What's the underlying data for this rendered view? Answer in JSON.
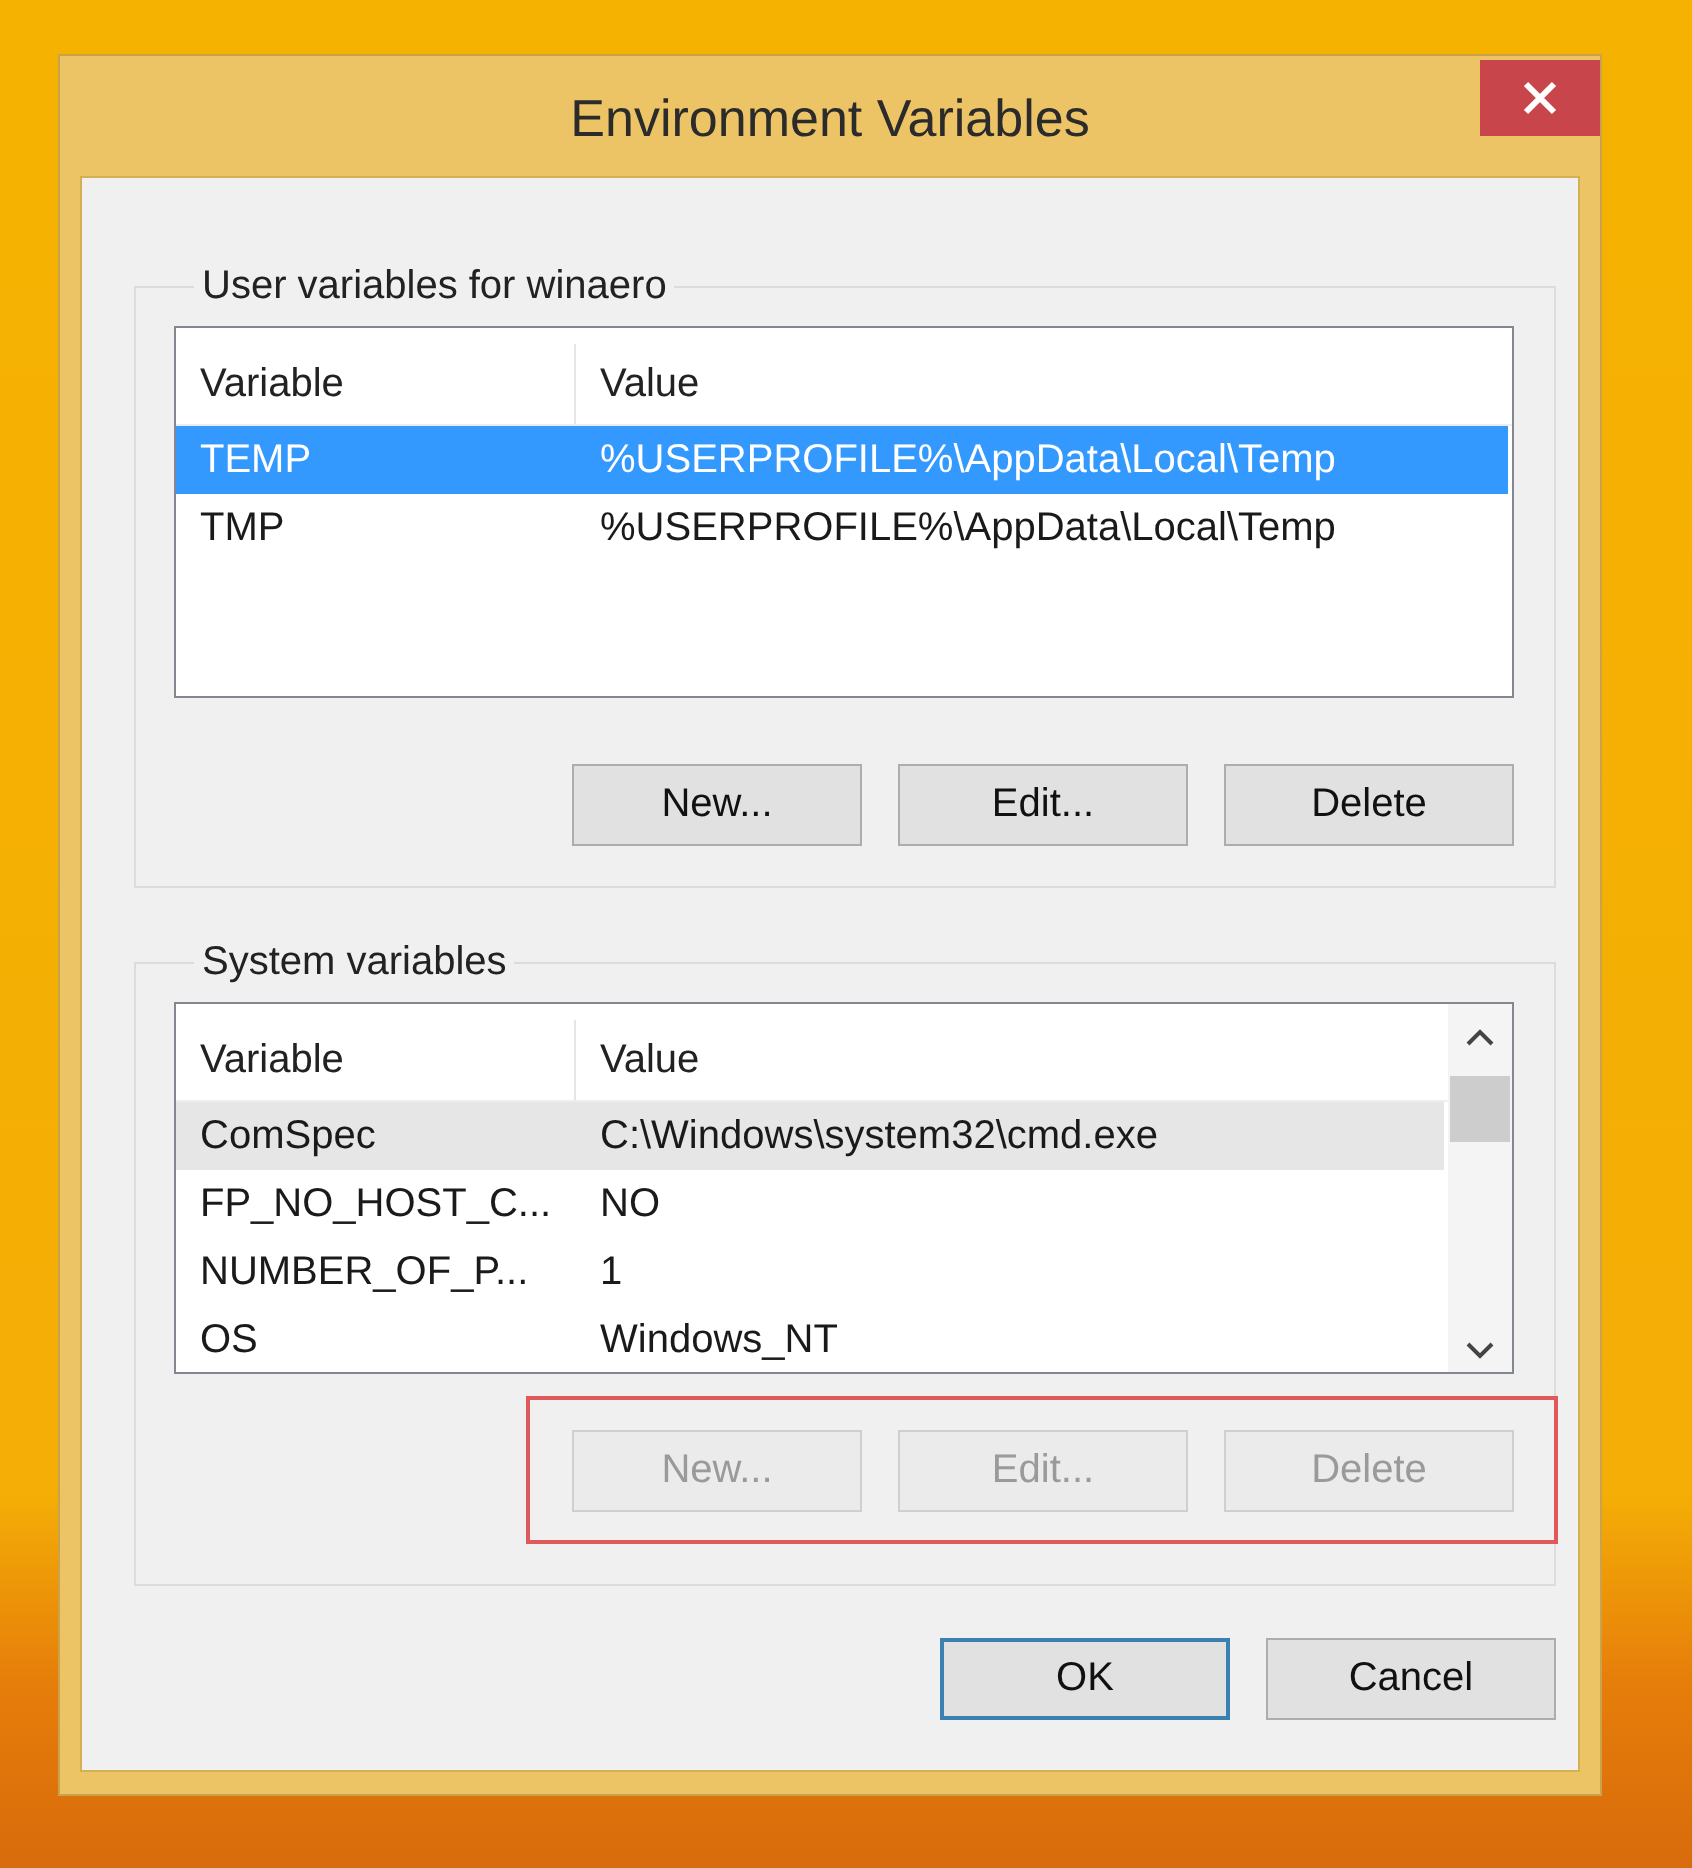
{
  "window": {
    "title": "Environment Variables"
  },
  "user_variables": {
    "title": "User variables for winaero",
    "focused": true,
    "highlighted": false,
    "scrollbar": false,
    "columns": [
      "Variable",
      "Value"
    ],
    "rows": [
      {
        "variable": "TEMP",
        "value": "%USERPROFILE%\\AppData\\Local\\Temp",
        "selected": true
      },
      {
        "variable": "TMP",
        "value": "%USERPROFILE%\\AppData\\Local\\Temp",
        "selected": false
      }
    ],
    "buttons": [
      {
        "label": "New...",
        "disabled": false
      },
      {
        "label": "Edit...",
        "disabled": false
      },
      {
        "label": "Delete",
        "disabled": false
      }
    ]
  },
  "system_variables": {
    "title": "System variables",
    "focused": false,
    "highlighted": true,
    "scrollbar": true,
    "columns": [
      "Variable",
      "Value"
    ],
    "rows": [
      {
        "variable": "ComSpec",
        "value": "C:\\Windows\\system32\\cmd.exe",
        "selected": true
      },
      {
        "variable": "FP_NO_HOST_C...",
        "value": "NO",
        "selected": false
      },
      {
        "variable": "NUMBER_OF_P...",
        "value": "1",
        "selected": false
      },
      {
        "variable": "OS",
        "value": "Windows_NT",
        "selected": false
      }
    ],
    "buttons": [
      {
        "label": "New...",
        "disabled": true
      },
      {
        "label": "Edit...",
        "disabled": true
      },
      {
        "label": "Delete",
        "disabled": true
      }
    ]
  },
  "footer_buttons": [
    {
      "label": "OK",
      "default": true
    },
    {
      "label": "Cancel",
      "default": false
    }
  ]
}
